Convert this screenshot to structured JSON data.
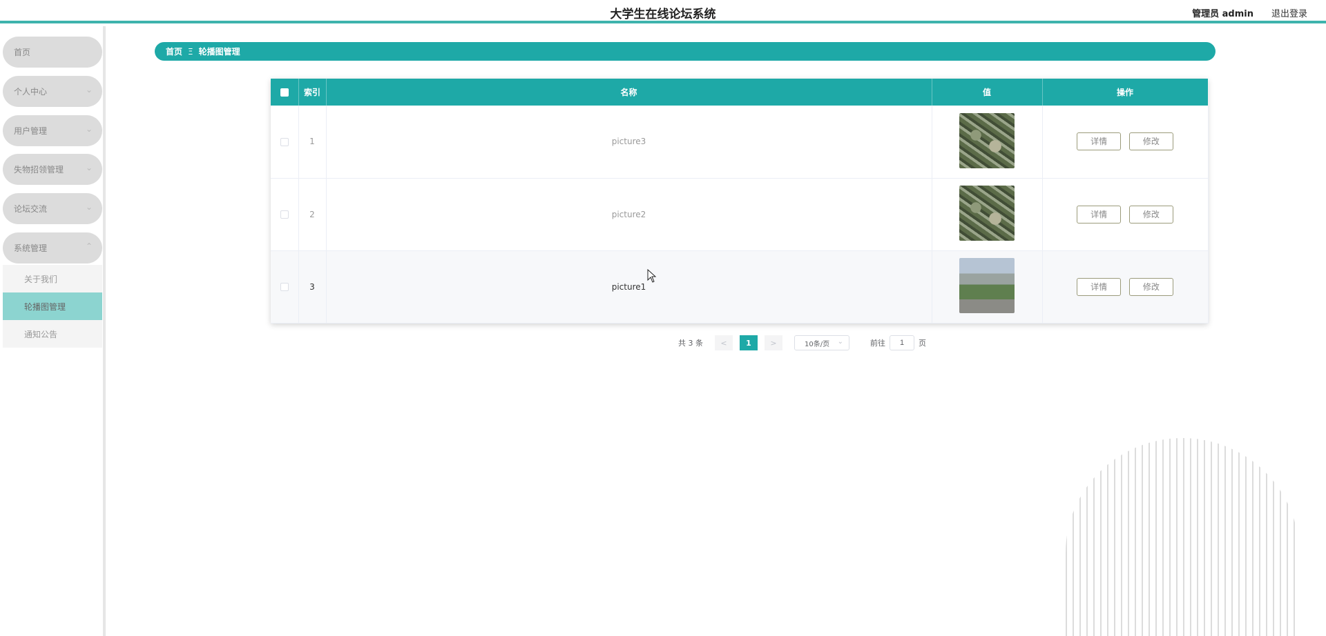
{
  "header": {
    "title": "大学生在线论坛系统",
    "user": "管理员 admin",
    "logout": "退出登录"
  },
  "sidebar": {
    "items": [
      {
        "label": "首页"
      },
      {
        "label": "个人中心"
      },
      {
        "label": "用户管理"
      },
      {
        "label": "失物招领管理"
      },
      {
        "label": "论坛交流"
      },
      {
        "label": "系统管理"
      }
    ],
    "submenu": [
      {
        "label": "关于我们"
      },
      {
        "label": "轮播图管理"
      },
      {
        "label": "通知公告"
      }
    ]
  },
  "breadcrumb": {
    "home": "首页",
    "separator": "Ξ",
    "current": "轮播图管理"
  },
  "table": {
    "columns": {
      "index": "索引",
      "name": "名称",
      "value": "值",
      "actions": "操作"
    },
    "rows": [
      {
        "index": "1",
        "name": "picture3",
        "image": "aerial-campus-photo",
        "detail": "详情",
        "edit": "修改"
      },
      {
        "index": "2",
        "name": "picture2",
        "image": "aerial-campus-photo",
        "detail": "详情",
        "edit": "修改"
      },
      {
        "index": "3",
        "name": "picture1",
        "image": "building-road-photo",
        "detail": "详情",
        "edit": "修改"
      }
    ]
  },
  "pagination": {
    "total": "共 3 条",
    "prev": "<",
    "current_page": "1",
    "next": ">",
    "page_size": "10条/页",
    "goto_prefix": "前往",
    "goto_value": "1",
    "goto_suffix": "页"
  },
  "colors": {
    "accent": "#1ea9a7",
    "header_border": "#3fb3ad",
    "submenu_active": "#8cd4d0"
  }
}
